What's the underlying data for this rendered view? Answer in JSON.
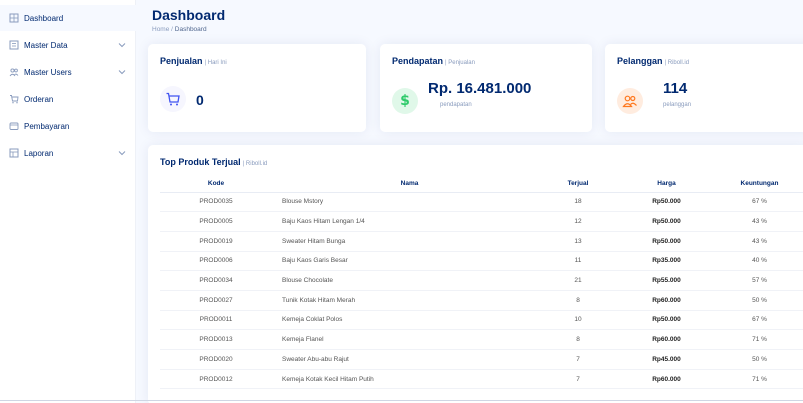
{
  "sidebar": {
    "items": [
      {
        "label": "Dashboard",
        "icon": "grid-icon",
        "expandable": false
      },
      {
        "label": "Master Data",
        "icon": "menu-icon",
        "expandable": true
      },
      {
        "label": "Master Users",
        "icon": "people-icon",
        "expandable": true
      },
      {
        "label": "Orderan",
        "icon": "cart-icon",
        "expandable": false
      },
      {
        "label": "Pembayaran",
        "icon": "card-icon",
        "expandable": false
      },
      {
        "label": "Laporan",
        "icon": "report-icon",
        "expandable": true
      }
    ]
  },
  "header": {
    "title": "Dashboard",
    "breadcrumb": {
      "home": "Home",
      "separator": " / ",
      "current": "Dashboard"
    }
  },
  "cards": {
    "penjualan": {
      "title": "Penjualan",
      "sub": "| Hari Ini",
      "value": "0",
      "caption": "",
      "icon": "cart-icon",
      "color": "#4154f1",
      "bg": "#f6f6fe"
    },
    "pendapatan": {
      "title": "Pendapatan",
      "sub": "| Penjualan",
      "value": "Rp. 16.481.000",
      "caption": "pendapatan",
      "icon": "dollar-icon",
      "color": "#2eca6a",
      "bg": "#e0f8e9"
    },
    "pelanggan": {
      "title": "Pelanggan",
      "sub": "| Riboll.id",
      "value": "114",
      "caption": "pelanggan",
      "icon": "people-icon",
      "color": "#ff771d",
      "bg": "#ffecdf"
    }
  },
  "top_products": {
    "title": "Top Produk Terjual",
    "sub": "| Riboll.id",
    "headers": {
      "kode": "Kode",
      "nama": "Nama",
      "terjual": "Terjual",
      "harga": "Harga",
      "keuntungan": "Keuntungan"
    },
    "rows": [
      {
        "kode": "PROD0035",
        "nama": "Blouse Mstory",
        "terjual": "18",
        "harga": "Rp50.000",
        "keuntungan": "67 %"
      },
      {
        "kode": "PROD0005",
        "nama": "Baju Kaos Hitam Lengan 1/4",
        "terjual": "12",
        "harga": "Rp50.000",
        "keuntungan": "43 %"
      },
      {
        "kode": "PROD0019",
        "nama": "Sweater Hitam Bunga",
        "terjual": "13",
        "harga": "Rp50.000",
        "keuntungan": "43 %"
      },
      {
        "kode": "PROD0006",
        "nama": "Baju Kaos Garis Besar",
        "terjual": "11",
        "harga": "Rp35.000",
        "keuntungan": "40 %"
      },
      {
        "kode": "PROD0034",
        "nama": "Blouse Chocolate",
        "terjual": "21",
        "harga": "Rp55.000",
        "keuntungan": "57 %"
      },
      {
        "kode": "PROD0027",
        "nama": "Tunik Kotak Hitam Merah",
        "terjual": "8",
        "harga": "Rp60.000",
        "keuntungan": "50 %"
      },
      {
        "kode": "PROD0011",
        "nama": "Kemeja Coklat Polos",
        "terjual": "10",
        "harga": "Rp50.000",
        "keuntungan": "67 %"
      },
      {
        "kode": "PROD0013",
        "nama": "Kemeja Flanel",
        "terjual": "8",
        "harga": "Rp60.000",
        "keuntungan": "71 %"
      },
      {
        "kode": "PROD0020",
        "nama": "Sweater Abu-abu Rajut",
        "terjual": "7",
        "harga": "Rp45.000",
        "keuntungan": "50 %"
      },
      {
        "kode": "PROD0012",
        "nama": "Kemeja Kotak Kecil Hitam Putih",
        "terjual": "7",
        "harga": "Rp60.000",
        "keuntungan": "71 %"
      }
    ]
  }
}
